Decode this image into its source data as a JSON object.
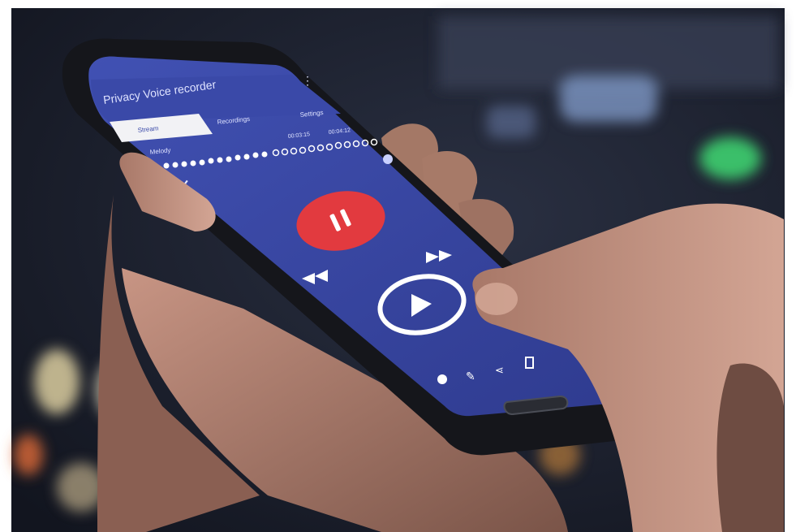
{
  "colors": {
    "frame": "#ffffff",
    "city_bg": "#1c2233",
    "screen": "#3b4aa6",
    "appbar": "#3f4fb0",
    "tab_active": "#f2f2f5",
    "record_button": "#e23a3f",
    "play_ring": "#ffffff",
    "phone_body": "#15161b",
    "skin": "#b98a78"
  },
  "app": {
    "title": "Privacy Voice recorder",
    "tabs": [
      {
        "label": "Stream",
        "active": true
      },
      {
        "label": "Recordings",
        "active": false
      },
      {
        "label": "Settings",
        "active": false
      }
    ],
    "track_label": "Melody",
    "time_left": "00:03:15",
    "time_right": "00:04:12"
  },
  "icons": {
    "record": "pause-icon",
    "rewind": "rewind-icon",
    "forward": "fast-forward-icon",
    "play": "play-icon",
    "shuffle": "shuffle-icon",
    "bottom": [
      "gear-icon",
      "edit-icon",
      "share-icon",
      "delete-icon"
    ]
  }
}
